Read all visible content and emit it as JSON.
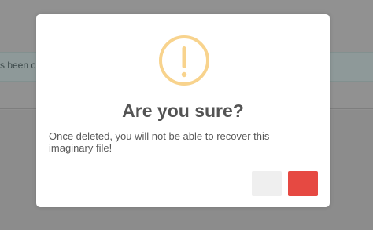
{
  "background": {
    "alert_text": "s been c"
  },
  "modal": {
    "icon": "warning-exclamation-icon",
    "title": "Are you sure?",
    "message": "Once deleted, you will not be able to recover this imaginary file!",
    "cancel_label": "",
    "confirm_label": ""
  },
  "colors": {
    "overlay": "#8c8c8c",
    "warning": "#f8d38d",
    "confirm": "#e64942",
    "cancel": "#efefef",
    "title": "#545454"
  }
}
